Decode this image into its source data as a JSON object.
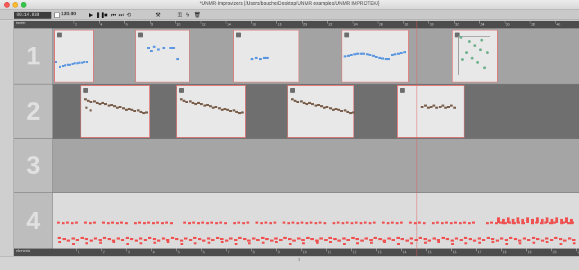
{
  "window": {
    "title": "*UNMR-Improvizers  [/Users/bouche/Desktop/UNMR examples/UNMR IMPROTEK/]"
  },
  "toolbar": {
    "time": "00:14.838",
    "tempo": "120.00",
    "icons": [
      "play-icon",
      "pause-icon",
      "stop-icon",
      "rewind-icon",
      "forward-icon",
      "loop-icon",
      "tool-icon",
      "key-icon",
      "trash-icon"
    ]
  },
  "ruler": {
    "label": "metric",
    "ticks": [
      "2",
      "4",
      "6",
      "8",
      "10",
      "12",
      "14",
      "16",
      "18",
      "20",
      "22",
      "24",
      "26",
      "28",
      "30",
      "32",
      "34",
      "36",
      "38",
      "40"
    ]
  },
  "bottom_ruler": {
    "label": "elements",
    "ticks": [
      "1",
      "2",
      "3",
      "4",
      "5",
      "6",
      "7",
      "8",
      "9",
      "10",
      "11",
      "12",
      "13",
      "14",
      "15",
      "16",
      "17",
      "18",
      "19",
      "20",
      "21"
    ]
  },
  "tracks": [
    {
      "number": "1"
    },
    {
      "number": "2"
    },
    {
      "number": "3"
    },
    {
      "number": "4"
    }
  ],
  "colors": {
    "blue_notes": "#5b97e0",
    "brown_notes": "#7a5f4c",
    "red_notes": "#ef5151",
    "clip_border": "#e07a7a",
    "playhead": "#e05a5a"
  }
}
